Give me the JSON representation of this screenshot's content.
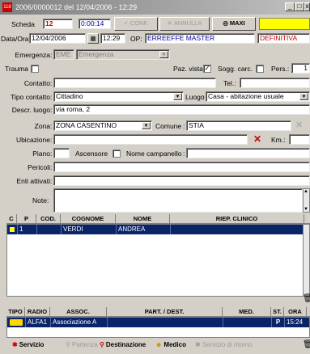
{
  "window": {
    "title": "2006/0000012 del 12/04/2006 - 12:29",
    "minimize_glyph": "_",
    "maximize_glyph": "□",
    "close_glyph": "x"
  },
  "toolbar": {
    "scheda_label": "Scheda",
    "scheda_value": "12",
    "elapsed": "0:00:14",
    "conf_label": "CONF.",
    "annulla_label": "ANNULLA",
    "maxi_label": "MAXI"
  },
  "header": {
    "dataora_label": "Data/Ora",
    "date_value": "12/04/2006",
    "time_value": "12:29",
    "op_label": "OP:",
    "op_value": "ERREEFFE MASTER",
    "status_value": "DEFINITIVA"
  },
  "form": {
    "emergenza_label": "Emergenza",
    "emergenza_code": "EME",
    "emergenza_value": "Emergenza",
    "trauma_label": "Trauma",
    "paz_vista_label": "Paz. vista",
    "sogg_carc_label": "Sogg. carc.",
    "pers_label": "Pers.:",
    "pers_value": "1",
    "contatto_label": "Contatto",
    "contatto_value": "",
    "tel_label": "Tel.:",
    "tel_value": "",
    "tipo_contatto_label": "Tipo contatto",
    "tipo_contatto_value": "Cittadino",
    "luogo_label": "Luogo",
    "luogo_value": "Casa - abitazione usuale",
    "descr_luogo_label": "Descr. luogo",
    "descr_luogo_value": "via roma, 2",
    "zona_label": "Zona",
    "zona_value": "ZONA CASENTINO",
    "comune_label": "Comune",
    "comune_value": "STIA",
    "ubicazione_label": "Ubicazione",
    "ubicazione_value": "",
    "km_label": "Km.:",
    "km_value": "",
    "piano_label": "Piano",
    "piano_value": "",
    "ascensore_label": "Ascensore",
    "nome_campanello_label": "Nome campanello",
    "nome_campanello_value": "",
    "pericoli_label": "Pericoli",
    "pericoli_value": "",
    "enti_attivati_label": "Enti attivati",
    "enti_attivati_value": "",
    "note_label": "Note",
    "note_value": ""
  },
  "patients": {
    "columns": [
      "C",
      "P",
      "COD.",
      "COGNOME",
      "NOME",
      "RIEP. CLINICO"
    ],
    "rows": [
      {
        "c": "",
        "p": "1",
        "cod": "",
        "cognome": "VERDI",
        "nome": "ANDREA",
        "riep": ""
      }
    ]
  },
  "missions": {
    "columns": [
      "TIPO",
      "RADIO",
      "ASSOC.",
      "PART. / DEST.",
      "MED.",
      "ST.",
      "ORA"
    ],
    "rows": [
      {
        "tipo": "",
        "radio": "ALFA1",
        "assoc": "Associazione A",
        "part_dest": "",
        "med": "",
        "st": "P",
        "ora": "15:24"
      }
    ]
  },
  "footer": {
    "servizio": "Servizio",
    "partenza": "Partenza",
    "destinazione": "Destinazione",
    "medico": "Medico",
    "servizio_ritorno": "Servizio di ritorno"
  },
  "colors": {
    "selection": "#0a246a",
    "accent_red": "#cc0000",
    "field_blue": "#0000a0",
    "status_yellow": "#ffff00"
  }
}
